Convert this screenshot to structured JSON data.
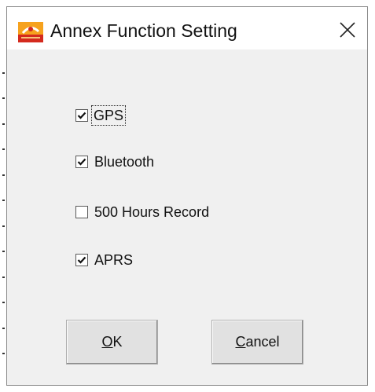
{
  "window": {
    "title": "Annex Function Setting",
    "close_glyph": "×"
  },
  "options": [
    {
      "label": "GPS",
      "checked": true,
      "focused": true
    },
    {
      "label": "Bluetooth",
      "checked": true,
      "focused": false
    },
    {
      "label": "500 Hours Record",
      "checked": false,
      "focused": false
    },
    {
      "label": "APRS",
      "checked": true,
      "focused": false
    }
  ],
  "buttons": {
    "ok": {
      "mnemonic": "O",
      "rest": "K"
    },
    "cancel": {
      "mnemonic": "C",
      "rest": "ancel"
    }
  },
  "icons": {
    "app": "app-logo-icon",
    "close": "close-icon",
    "check": "checkmark-icon"
  },
  "colors": {
    "window_bg": "#f0f0f0",
    "titlebar_bg": "#ffffff",
    "button_bg": "#e1e1e1",
    "icon_orange": "#e8901a",
    "icon_red": "#d42a1e"
  }
}
